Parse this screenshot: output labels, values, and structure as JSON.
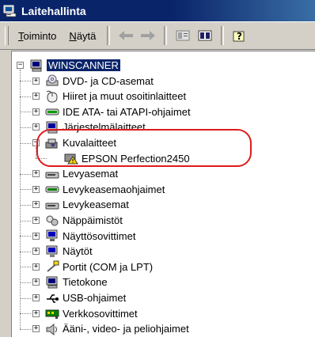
{
  "window": {
    "title": "Laitehallinta"
  },
  "menu": {
    "items": [
      {
        "label": "Toiminto",
        "underline": "T",
        "rest": "oiminto"
      },
      {
        "label": "Näytä",
        "underline": "N",
        "rest": "äytä"
      }
    ]
  },
  "toolbar": {
    "icons": [
      "back-arrow-icon",
      "forward-arrow-icon",
      "properties-icon",
      "view-icon",
      "help-icon"
    ]
  },
  "tree": {
    "root": "WINSCANNER",
    "categories": [
      {
        "label": "DVD- ja CD-asemat",
        "icon": "cdrom-icon"
      },
      {
        "label": "Hiiret ja muut osoitinlaitteet",
        "icon": "mouse-icon"
      },
      {
        "label": "IDE ATA- tai ATAPI-ohjaimet",
        "icon": "ide-controller-icon"
      },
      {
        "label": "Järjestelmälaitteet",
        "icon": "system-devices-icon"
      },
      {
        "label": "Kuvalaitteet",
        "icon": "imaging-device-icon",
        "expanded": true,
        "children": [
          {
            "label": "EPSON Perfection2450",
            "icon": "warning-device-icon"
          }
        ]
      },
      {
        "label": "Levyasemat",
        "icon": "floppy-drive-icon"
      },
      {
        "label": "Levykeasemaohjaimet",
        "icon": "floppy-controller-icon"
      },
      {
        "label": "Levykeasemat",
        "icon": "floppy-drive-icon"
      },
      {
        "label": "Näppäimistöt",
        "icon": "keyboard-icon"
      },
      {
        "label": "Näyttösovittimet",
        "icon": "display-adapter-icon"
      },
      {
        "label": "Näytöt",
        "icon": "monitor-icon"
      },
      {
        "label": "Portit (COM ja LPT)",
        "icon": "port-icon"
      },
      {
        "label": "Tietokone",
        "icon": "computer-icon"
      },
      {
        "label": "USB-ohjaimet",
        "icon": "usb-icon"
      },
      {
        "label": "Verkkosovittimet",
        "icon": "network-adapter-icon"
      },
      {
        "label": "Ääni-, video- ja peliohjaimet",
        "icon": "sound-icon"
      }
    ]
  },
  "colors": {
    "title_bar": "#0a246a",
    "selection": "#0a246a",
    "highlight_ring": "#e01a1a",
    "chrome": "#d4d0c8"
  }
}
